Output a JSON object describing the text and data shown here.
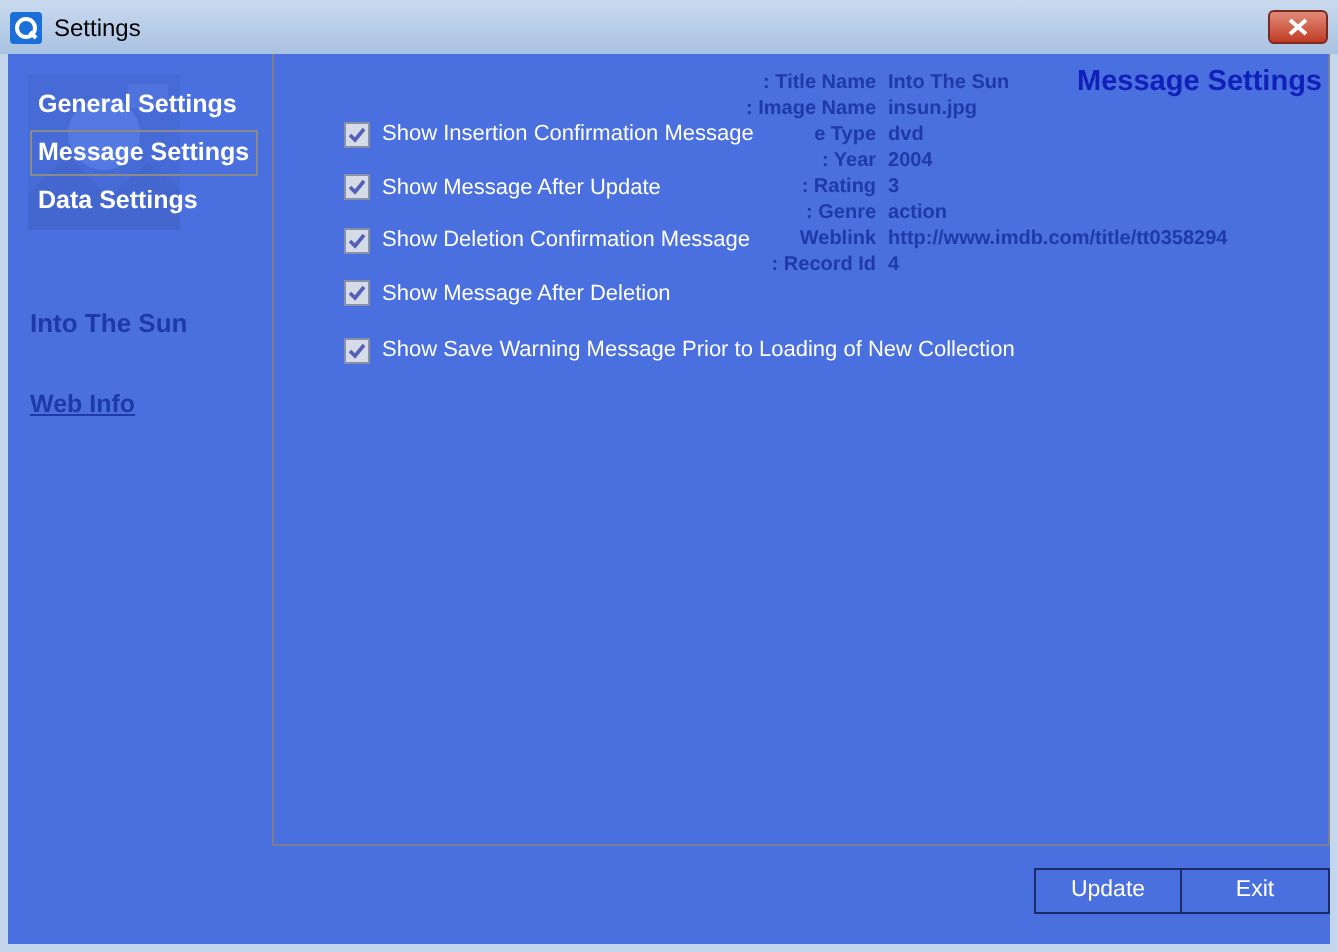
{
  "window": {
    "title": "Settings"
  },
  "sidebar": {
    "items": [
      {
        "label": "General Settings",
        "selected": false
      },
      {
        "label": "Message Settings",
        "selected": true
      },
      {
        "label": "Data Settings",
        "selected": false
      }
    ],
    "background_title": "Into The Sun",
    "background_link": "Web Info"
  },
  "panel": {
    "heading": "Message Settings",
    "background_fields": [
      {
        "label": ": Title Name",
        "value": "Into The Sun"
      },
      {
        "label": ": Image Name",
        "value": "insun.jpg"
      },
      {
        "label": "e Type",
        "value": "dvd"
      },
      {
        "label": ": Year",
        "value": "2004"
      },
      {
        "label": ": Rating",
        "value": "3"
      },
      {
        "label": ": Genre",
        "value": "action"
      },
      {
        "label": "Weblink",
        "value": "http://www.imdb.com/title/tt0358294"
      },
      {
        "label": ": Record Id",
        "value": "4"
      }
    ],
    "options": [
      {
        "label": "Show Insertion Confirmation Message",
        "checked": true
      },
      {
        "label": "Show Message After Update",
        "checked": true
      },
      {
        "label": "Show Deletion Confirmation Message",
        "checked": true
      },
      {
        "label": "Show Message After Deletion",
        "checked": true
      },
      {
        "label": "Show Save Warning Message Prior to Loading of New Collection",
        "checked": true
      }
    ]
  },
  "buttons": [
    "Update",
    "Exit"
  ]
}
